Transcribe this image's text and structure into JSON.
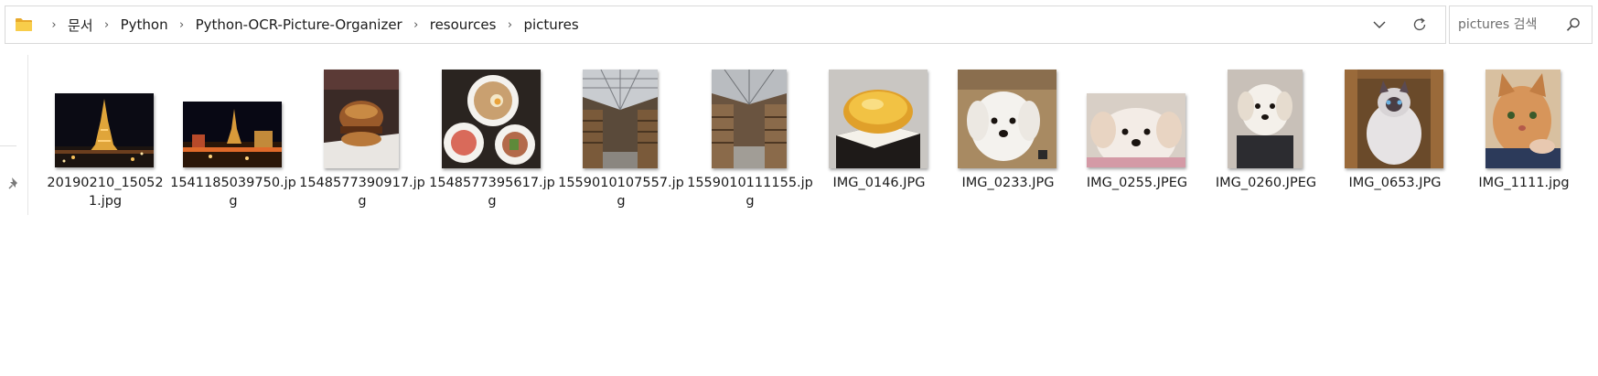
{
  "address_bar": {
    "breadcrumbs": [
      "문서",
      "Python",
      "Python-OCR-Picture-Organizer",
      "resources",
      "pictures"
    ],
    "separator": "›"
  },
  "search": {
    "placeholder": "pictures 검색"
  },
  "icons": {
    "folder": "folder-icon",
    "dropdown": "chevron-down-icon",
    "refresh": "refresh-icon",
    "search": "search-icon",
    "pin": "pin-icon"
  },
  "colors": {
    "folder_yellow": "#f4c542",
    "border": "#d9d9d9",
    "text": "#1b1b1b"
  },
  "files": [
    {
      "name": "20190210_150521.jpg",
      "subject": "eiffel-tower-night-thumbnail"
    },
    {
      "name": "1541185039750.jpg",
      "subject": "las-vegas-night-thumbnail"
    },
    {
      "name": "1548577390917.jpg",
      "subject": "burger-thumbnail"
    },
    {
      "name": "1548577395617.jpg",
      "subject": "ramen-dishes-thumbnail"
    },
    {
      "name": "1559010107557.jpg",
      "subject": "arcade-glass-roof-thumbnail"
    },
    {
      "name": "1559010111155.jpg",
      "subject": "arcade-atrium-thumbnail"
    },
    {
      "name": "IMG_0146.JPG",
      "subject": "cheese-tart-thumbnail"
    },
    {
      "name": "IMG_0233.JPG",
      "subject": "white-puppy-thumbnail"
    },
    {
      "name": "IMG_0255.JPEG",
      "subject": "puppy-closeup-thumbnail"
    },
    {
      "name": "IMG_0260.JPEG",
      "subject": "puppy-sweater-thumbnail"
    },
    {
      "name": "IMG_0653.JPG",
      "subject": "ragdoll-cat-thumbnail"
    },
    {
      "name": "IMG_1111.jpg",
      "subject": "orange-cat-thumbnail"
    }
  ]
}
